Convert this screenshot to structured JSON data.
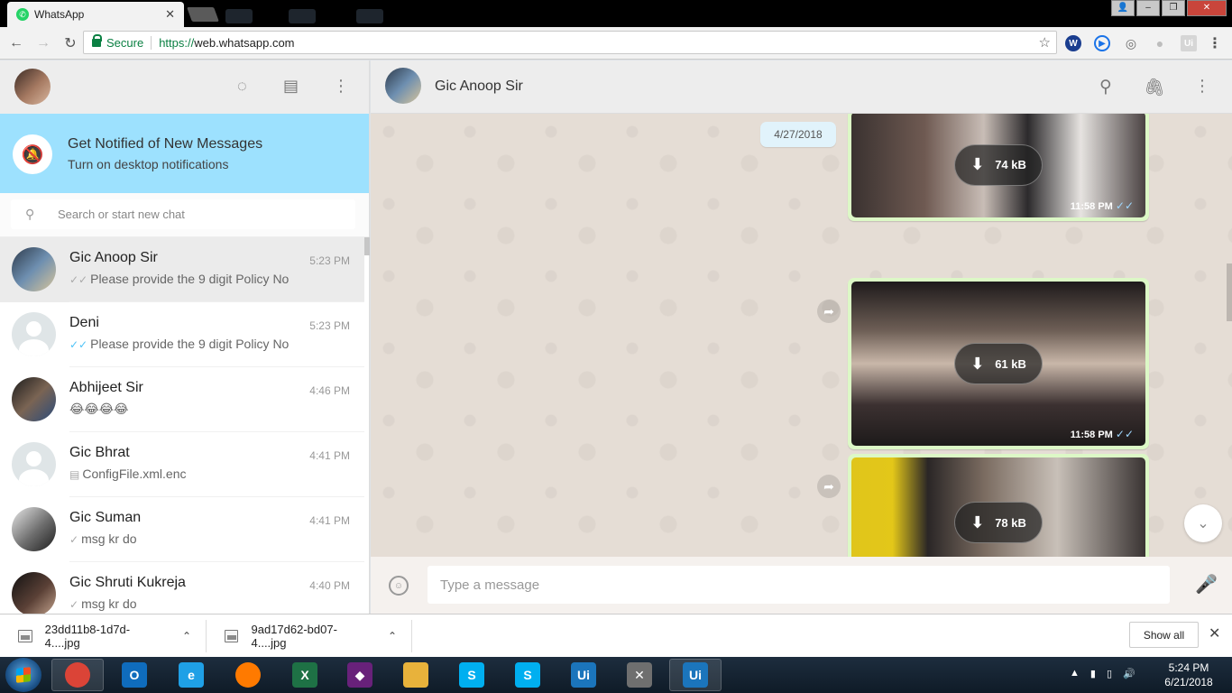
{
  "browser": {
    "tab_title": "WhatsApp",
    "tab_close": "✕",
    "secure_label": "Secure",
    "url_scheme": "https://",
    "url_rest": "web.whatsapp.com",
    "extensions": [
      {
        "icon": "w-extension-icon",
        "glyph": "W",
        "color": "#1a3d8f"
      },
      {
        "icon": "play-extension-icon",
        "glyph": "▶",
        "color": "#1a73e8"
      },
      {
        "icon": "eye-extension-icon",
        "glyph": "◎",
        "color": "#6b6b6b"
      },
      {
        "icon": "circle-extension-icon",
        "glyph": "●",
        "color": "#bdbdbd"
      },
      {
        "icon": "ui-extension-icon",
        "glyph": "Ui",
        "color": "#9e9e9e"
      }
    ]
  },
  "sidebar": {
    "notification": {
      "title": "Get Notified of New Messages",
      "subtitle": "Turn on desktop notifications"
    },
    "search": {
      "placeholder": "Search or start new chat"
    },
    "chats": [
      {
        "name": "Gic Anoop Sir",
        "time": "5:23 PM",
        "tick": "✓✓",
        "tick_read": false,
        "message": "Please provide the 9 digit Policy No",
        "active": true
      },
      {
        "name": "Deni",
        "time": "5:23 PM",
        "tick": "✓✓",
        "tick_read": true,
        "message": "Please provide the 9 digit Policy No",
        "active": false
      },
      {
        "name": "Abhijeet Sir",
        "time": "4:46 PM",
        "tick": "",
        "tick_read": false,
        "message": "😂😂😂😂",
        "active": false
      },
      {
        "name": "Gic Bhrat",
        "time": "4:41 PM",
        "tick": "▤",
        "tick_read": false,
        "message": "ConfigFile.xml.enc",
        "active": false
      },
      {
        "name": "Gic Suman",
        "time": "4:41 PM",
        "tick": "✓",
        "tick_read": false,
        "message": "msg kr do",
        "active": false
      },
      {
        "name": "Gic Shruti Kukreja",
        "time": "4:40 PM",
        "tick": "✓",
        "tick_read": false,
        "message": "msg kr do",
        "active": false
      }
    ]
  },
  "conversation": {
    "contact_name": "Gic Anoop Sir",
    "date_chip": "4/27/2018",
    "images": [
      {
        "size": "74 kB",
        "time": "11:58 PM",
        "tick": "✓✓"
      },
      {
        "size": "61 kB",
        "time": "11:58 PM",
        "tick": "✓✓"
      },
      {
        "size": "78 kB",
        "time": "",
        "tick": ""
      }
    ],
    "compose_placeholder": "Type a message"
  },
  "downloads": {
    "files": [
      "23dd11b8-1d7d-4....jpg",
      "9ad17d62-bd07-4....jpg"
    ],
    "show_all": "Show all"
  },
  "taskbar": {
    "time": "5:24 PM",
    "date": "6/21/2018",
    "apps": [
      {
        "name": "chrome",
        "label": "",
        "color": "#db4437",
        "open": true
      },
      {
        "name": "outlook",
        "label": "O",
        "color": "#0f6cbd",
        "open": false
      },
      {
        "name": "internet-explorer",
        "label": "e",
        "color": "#1fa0e6",
        "open": false
      },
      {
        "name": "firefox",
        "label": "",
        "color": "#ff7a00",
        "open": false
      },
      {
        "name": "excel",
        "label": "X",
        "color": "#1e7145",
        "open": false
      },
      {
        "name": "visual-studio",
        "label": "◆",
        "color": "#68217a",
        "open": false
      },
      {
        "name": "file-explorer",
        "label": "",
        "color": "#e8b23b",
        "open": false
      },
      {
        "name": "skype",
        "label": "S",
        "color": "#00aff0",
        "open": false
      },
      {
        "name": "skype-business",
        "label": "S",
        "color": "#00aff0",
        "open": false
      },
      {
        "name": "uipath",
        "label": "Ui",
        "color": "#1b75bc",
        "open": false
      },
      {
        "name": "tools",
        "label": "✕",
        "color": "#6f6f6f",
        "open": false
      },
      {
        "name": "uipath-studio",
        "label": "Ui",
        "color": "#1b75bc",
        "open": true
      }
    ]
  }
}
